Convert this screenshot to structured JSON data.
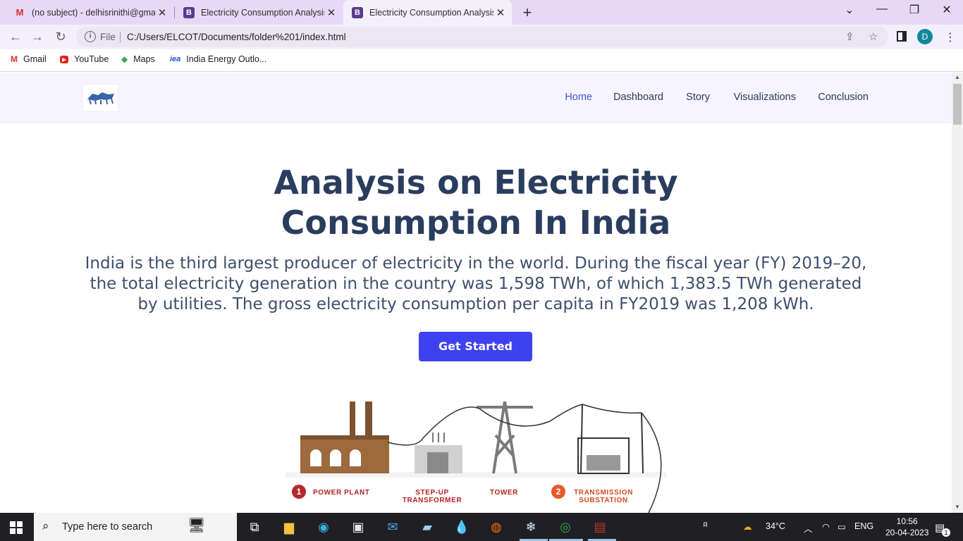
{
  "browser": {
    "tabs": [
      {
        "title": "(no subject) - delhisrinithi@gmai",
        "favicon": "gmail-icon",
        "active": false
      },
      {
        "title": "Electricity Consumption Analysis",
        "favicon": "bootstrap-icon",
        "active": false
      },
      {
        "title": "Electricity Consumption Analysis",
        "favicon": "bootstrap-icon",
        "active": true
      }
    ],
    "new_tab": "+",
    "address": {
      "scheme": "File",
      "url": "C:/Users/ELCOT/Documents/folder%201/index.html"
    },
    "profile_initial": "D",
    "bookmarks": [
      {
        "label": "Gmail",
        "icon": "gmail-icon"
      },
      {
        "label": "YouTube",
        "icon": "youtube-icon"
      },
      {
        "label": "Maps",
        "icon": "maps-icon"
      },
      {
        "label": "India Energy Outlo...",
        "icon": "iea-icon"
      }
    ]
  },
  "site": {
    "nav": [
      {
        "label": "Home",
        "active": true
      },
      {
        "label": "Dashboard",
        "active": false
      },
      {
        "label": "Story",
        "active": false
      },
      {
        "label": "Visualizations",
        "active": false
      },
      {
        "label": "Conclusion",
        "active": false
      }
    ],
    "hero": {
      "title_line1": "Analysis on Electricity",
      "title_line2": "Consumption In India",
      "text": "India is the third largest producer of electricity in the world. During the fiscal year (FY) 2019–20, the total electricity generation in the country was 1,598 TWh, of which 1,383.5 TWh generated by utilities. The gross electricity consumption per capita in FY2019 was 1,208 kWh.",
      "cta": "Get Started"
    },
    "illustration": {
      "labels": [
        {
          "num": "1",
          "text": "POWER PLANT"
        },
        {
          "num": "",
          "text": "STEP-UP TRANSFORMER"
        },
        {
          "num": "",
          "text": "TOWER"
        },
        {
          "num": "2",
          "text": "TRANSMISSION SUBSTATION"
        }
      ]
    }
  },
  "taskbar": {
    "search_placeholder": "Type here to search",
    "weather": "34°C",
    "language": "ENG",
    "time": "10:56",
    "date": "20-04-2023",
    "notifications": "1"
  },
  "colors": {
    "tab_strip": "#e7d9f6",
    "header_bg": "#f5f4ff",
    "accent": "#3e41f0",
    "title": "#2a3d5f"
  }
}
